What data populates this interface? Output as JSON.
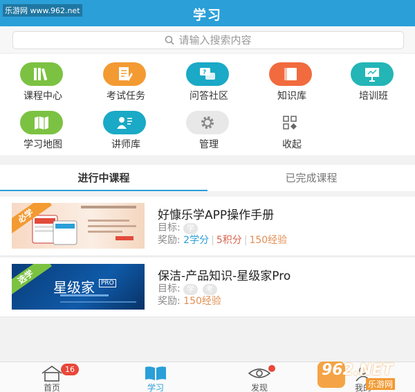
{
  "watermark_top": "乐游网 www.962.net",
  "header": {
    "title": "学习"
  },
  "search": {
    "placeholder": "请输入搜索内容"
  },
  "grid": [
    {
      "label": "课程中心",
      "icon": "books-icon",
      "color": "#7cc242"
    },
    {
      "label": "考试任务",
      "icon": "exam-paper-icon",
      "color": "#f39a32"
    },
    {
      "label": "问答社区",
      "icon": "chat-question-icon",
      "color": "#1aa9c6"
    },
    {
      "label": "知识库",
      "icon": "book-icon",
      "color": "#f16b3e"
    },
    {
      "label": "培训班",
      "icon": "presentation-icon",
      "color": "#24b5b7"
    },
    {
      "label": "学习地图",
      "icon": "map-icon",
      "color": "#7cc242"
    },
    {
      "label": "讲师库",
      "icon": "lecturer-icon",
      "color": "#1aa9c6"
    },
    {
      "label": "管理",
      "icon": "gear-icon",
      "color": "#e5e5e5"
    },
    {
      "label": "收起",
      "icon": "grid-collapse-icon",
      "color": "#ffffff"
    }
  ],
  "tabs": {
    "in_progress": "进行中课程",
    "completed": "已完成课程"
  },
  "courses": [
    {
      "ribbon": "必学",
      "ribbon_color": "#f39a32",
      "title": "好慷乐学APP操作手册",
      "goal_label": "目标:",
      "tags": [
        "学"
      ],
      "reward_label": "奖励:",
      "reward_study": "2学分",
      "reward_points": "5积分",
      "reward_exp": "150经验"
    },
    {
      "ribbon": "选学",
      "ribbon_color": "#7cc242",
      "thumb_text": "星级家",
      "thumb_badge": "PRO",
      "title": "保洁-产品知识-星级家Pro",
      "goal_label": "目标:",
      "tags": [
        "学",
        "考"
      ],
      "reward_label": "奖励:",
      "reward_exp": "150经验"
    }
  ],
  "bottom_nav": [
    {
      "label": "首页",
      "icon": "home-icon",
      "badge": "16"
    },
    {
      "label": "学习",
      "icon": "open-book-icon",
      "active": true
    },
    {
      "label": "发现",
      "icon": "eye-icon",
      "dot": true
    },
    {
      "label": "我的",
      "icon": "user-icon"
    }
  ],
  "watermark_br": {
    "main": "962.NET",
    "sub": "乐游网"
  }
}
